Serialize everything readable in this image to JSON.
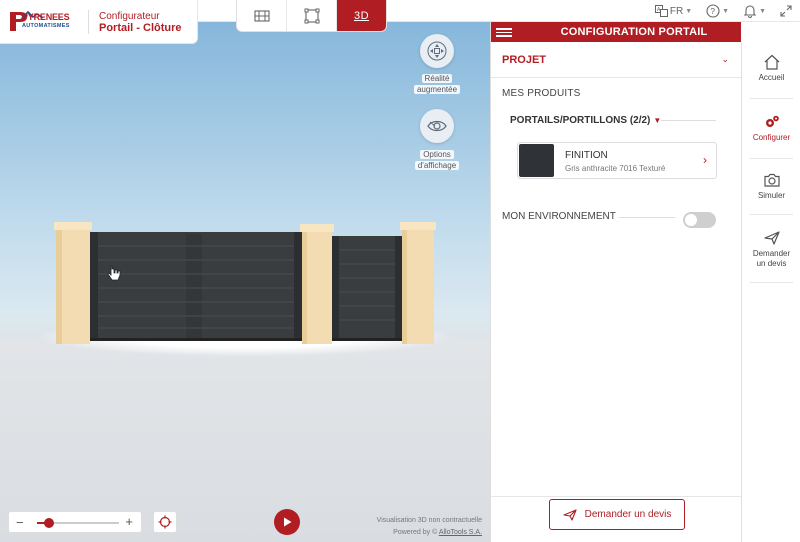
{
  "brand": {
    "logo_top": "PYRENEES",
    "logo_bottom": "AUTOMATISMES",
    "subtitle": "Configurateur",
    "title": "Portail - Clôture"
  },
  "view_tabs": [
    {
      "icon": "gate-front-view-icon",
      "label": ""
    },
    {
      "icon": "plan-view-icon",
      "label": ""
    },
    {
      "icon": "3d-view-icon",
      "label": "3D",
      "active": true
    }
  ],
  "top_right": {
    "language": "FR"
  },
  "viewport": {
    "ar_label_1": "Réalité",
    "ar_label_2": "augmentée",
    "display_label_1": "Options",
    "display_label_2": "d'affichage",
    "zoom_level": 0.15,
    "disclaimer": "Visualisation 3D non contractuelle",
    "powered_prefix": "Powered by © ",
    "powered_link": "AlloTools S.A."
  },
  "panel": {
    "header": "CONFIGURATION PORTAIL",
    "projet": "PROJET",
    "mes_produits": "MES PRODUITS",
    "portails": "PORTAILS/PORTILLONS (2/2)",
    "finition_title": "FINITION",
    "finition_value": "Gris anthracite 7016 Texturé",
    "finition_color": "#2f3236",
    "environment": "MON ENVIRONNEMENT",
    "environment_on": false,
    "devis_button": "Demander un devis"
  },
  "right_nav": {
    "accueil": "Accueil",
    "configurer": "Configurer",
    "simuler": "Simuler",
    "demander_1": "Demander",
    "demander_2": "un devis"
  },
  "colors": {
    "accent": "#b01e24",
    "pillar": "#f3dcb1",
    "gate": "#3a3d40"
  }
}
